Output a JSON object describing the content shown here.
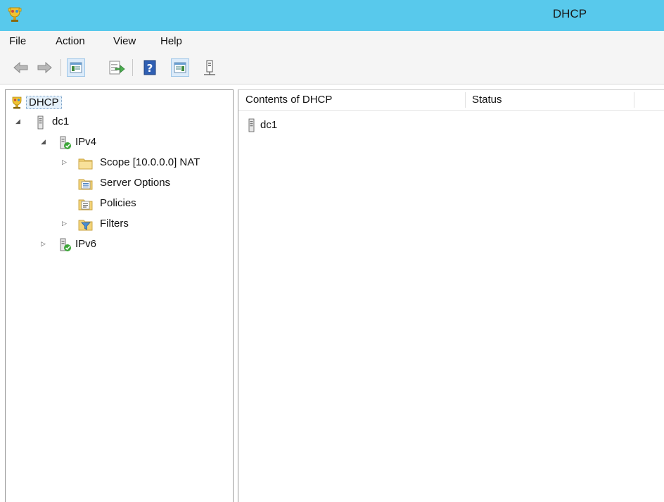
{
  "window": {
    "title": "DHCP",
    "colors": {
      "titlebar": "#58c9ec",
      "menubar": "#f5f5f5"
    }
  },
  "menu": {
    "items": [
      "File",
      "Action",
      "View",
      "Help"
    ]
  },
  "toolbar": {
    "buttons": [
      {
        "name": "back-icon"
      },
      {
        "name": "forward-icon"
      },
      {
        "name": "show-hide-console-tree-icon"
      },
      {
        "name": "export-list-icon"
      },
      {
        "name": "help-icon"
      },
      {
        "name": "show-hide-action-pane-icon"
      },
      {
        "name": "server-icon"
      }
    ]
  },
  "tree": {
    "root": {
      "label": "DHCP"
    },
    "server": {
      "label": "dc1"
    },
    "ipv4": {
      "label": "IPv4"
    },
    "scope": {
      "label": "Scope [10.0.0.0] NAT"
    },
    "server_options": {
      "label": "Server Options"
    },
    "policies": {
      "label": "Policies"
    },
    "filters": {
      "label": "Filters"
    },
    "ipv6": {
      "label": "IPv6"
    }
  },
  "list": {
    "columns": [
      "Contents of DHCP",
      "Status"
    ],
    "rows": [
      {
        "name": "dc1",
        "status": ""
      }
    ]
  }
}
